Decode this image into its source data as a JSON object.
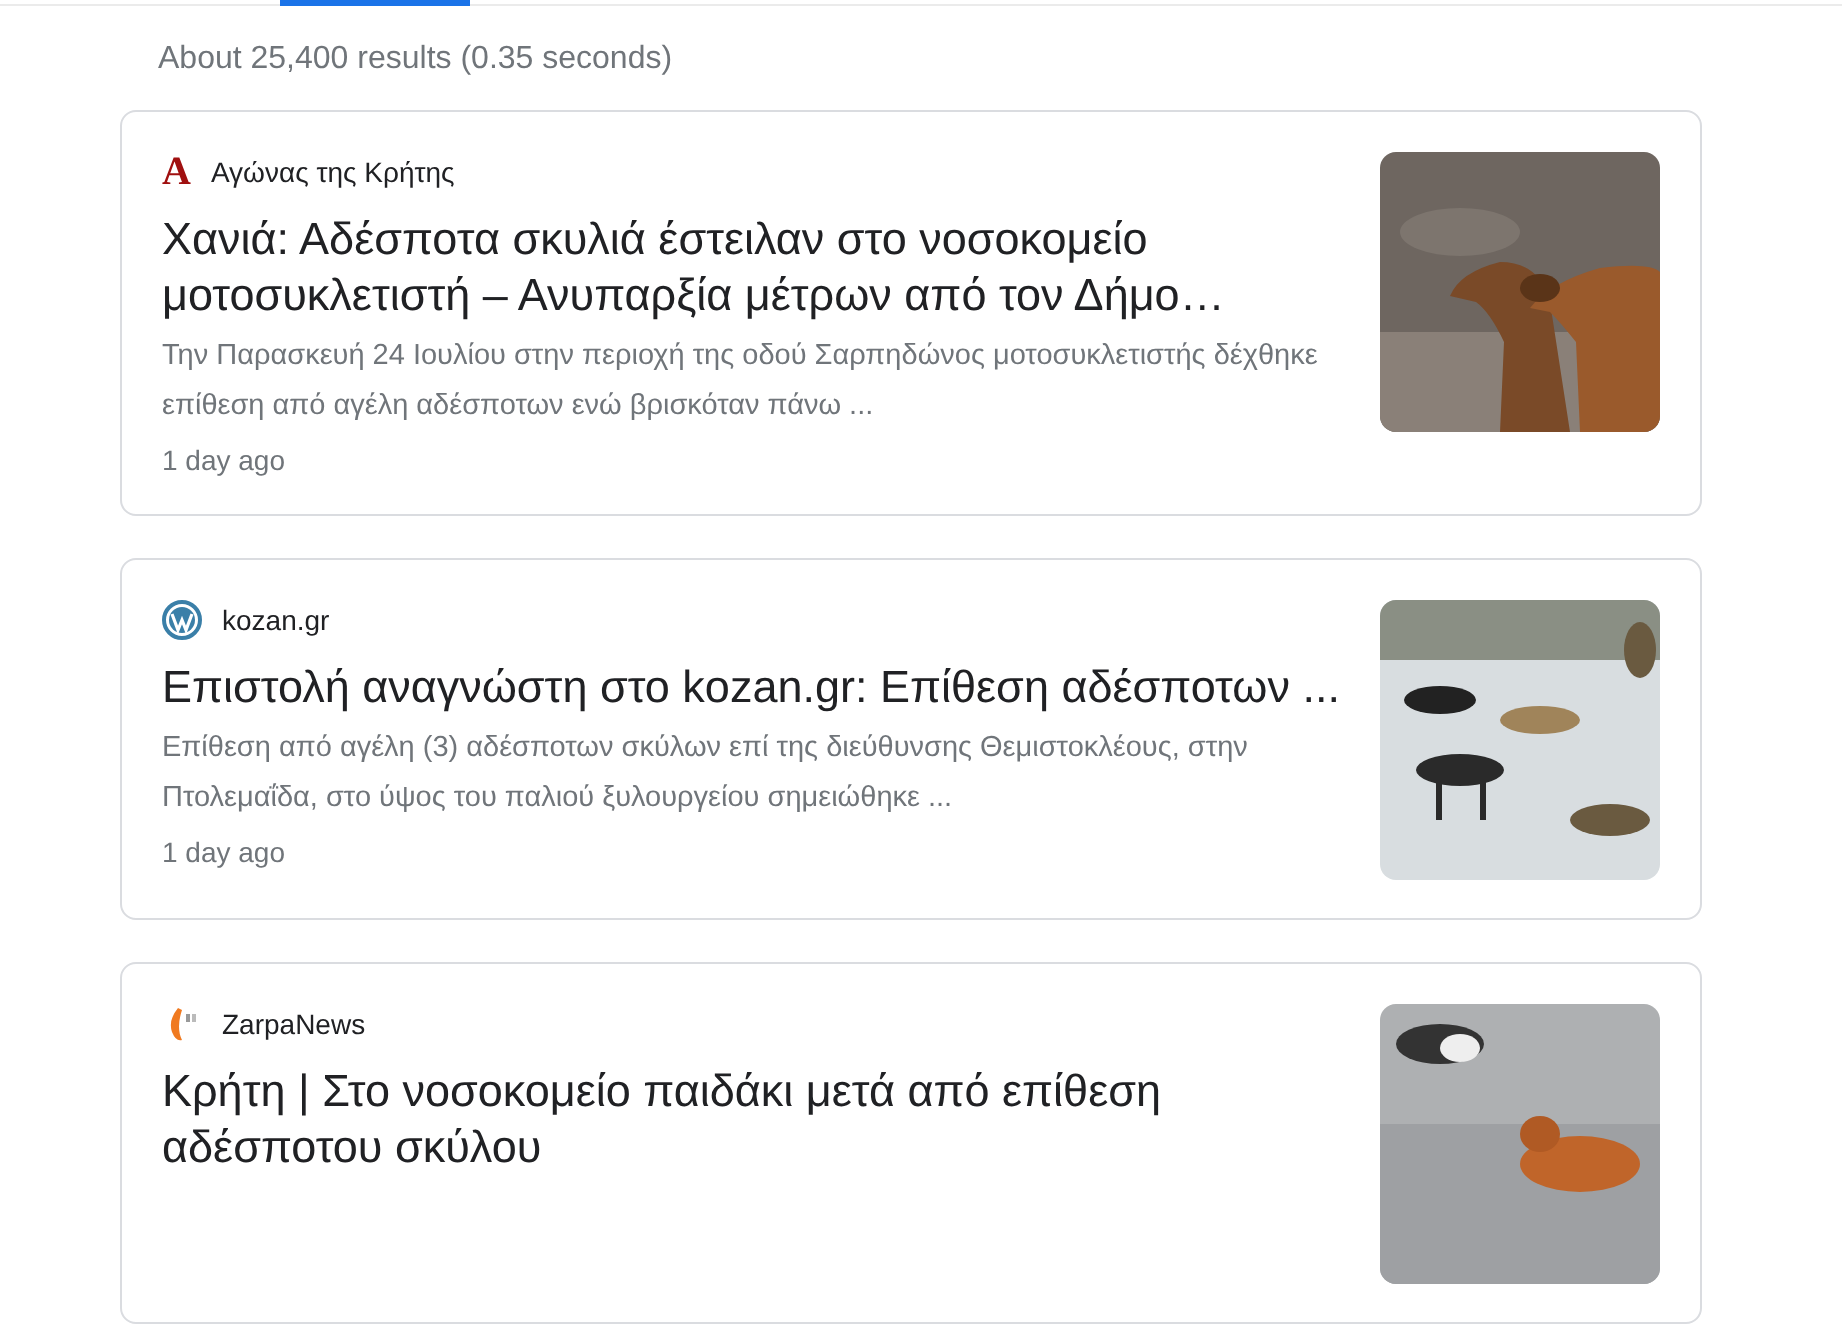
{
  "result_stats": "About 25,400 results (0.35 seconds)",
  "results": [
    {
      "source": "Αγώνας της Κρήτης",
      "logo": {
        "kind": "letter",
        "text": "A"
      },
      "title": "Χανιά: Αδέσποτα σκυλιά έστειλαν στο νοσοκομείο μοτοσυκλετιστή – Ανυπαρξία μέτρων από τον Δήμο…",
      "snippet": "Την Παρασκευή 24 Ιουλίου στην περιοχή της οδού Σαρπηδώνος μοτοσυκλετιστής δέχθηκε επίθεση από αγέλη αδέσποτων ενώ βρισκόταν πάνω ...",
      "time": "1 day ago"
    },
    {
      "source": "kozan.gr",
      "logo": {
        "kind": "wordpress"
      },
      "title": "Επιστολή αναγνώστη στο kozan.gr: Επίθεση αδέσποτων ...",
      "snippet": "Επίθεση από αγέλη (3) αδέσποτων σκύλων επί της διεύθυνσης Θεμιστοκλέους, στην Πτολεμαΐδα, στο ύψος του παλιού ξυλουργείου σημειώθηκε ...",
      "time": "1 day ago"
    },
    {
      "source": "ZarpaNews",
      "logo": {
        "kind": "flame"
      },
      "title": "Κρήτη | Στο νοσοκομείο παιδάκι μετά από επίθεση αδέσποτου σκύλου"
    }
  ]
}
